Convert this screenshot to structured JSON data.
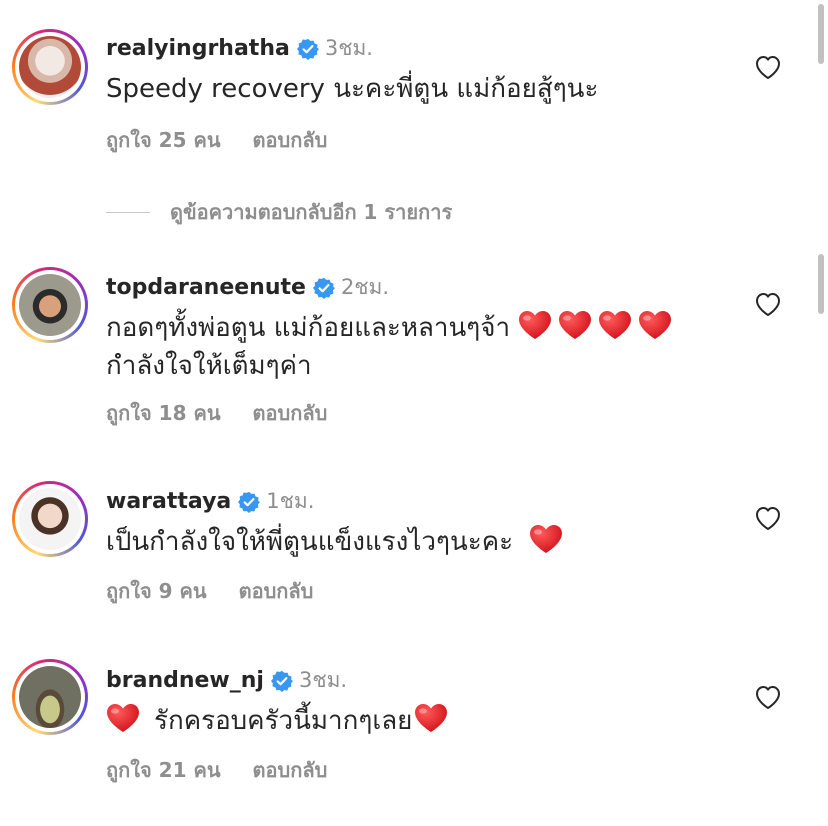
{
  "comments": [
    {
      "username": "realyingrhatha",
      "time": "3ชม.",
      "lines": [
        "Speedy recovery นะคะพี่ตูน แม่ก้อยสู้ๆนะ"
      ],
      "likes": "ถูกใจ 25 คน",
      "reply": "ตอบกลับ"
    },
    {
      "username": "topdaraneenute",
      "time": "2ชม.",
      "lines": [
        "กอดๆทั้งพ่อตูน แม่ก้อยและหลานๆจ้า",
        "กำลังใจให้เต็มๆค่า"
      ],
      "likes": "ถูกใจ 18 คน",
      "reply": "ตอบกลับ"
    },
    {
      "username": "warattaya",
      "time": "1ชม.",
      "lines": [
        "เป็นกำลังใจให้พี่ตูนแข็งแรงไวๆนะคะ"
      ],
      "likes": "ถูกใจ 9 คน",
      "reply": "ตอบกลับ"
    },
    {
      "username": "brandnew_nj",
      "time": "3ชม.",
      "lines": [
        "รักครอบครัวนี้มากๆเลย"
      ],
      "likes": "ถูกใจ 21 คน",
      "reply": "ตอบกลับ"
    }
  ],
  "view_replies": "ดูข้อความตอบกลับอีก 1 รายการ",
  "icons": {
    "verified": "verified-badge-icon",
    "like": "heart-outline-icon",
    "emoji": "red-heart-emoji"
  },
  "colors": {
    "verified_blue": "#3897f0",
    "muted": "#8e8e8e",
    "heart_red": "#e0262b"
  }
}
